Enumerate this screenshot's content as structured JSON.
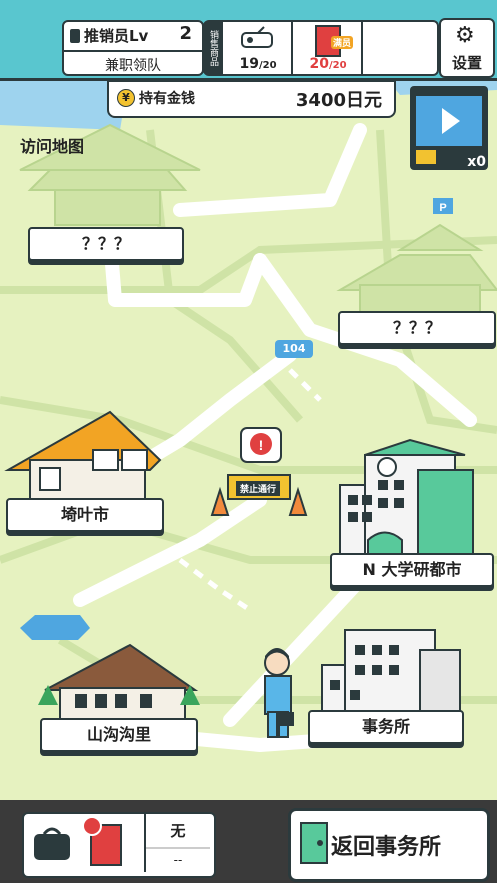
{
  "header": {
    "rank_label": "推销员Lv",
    "rank_level": "2",
    "team_name": "兼职领队",
    "sales_label": "销售商品",
    "slot1_count": "19",
    "slot1_max": "/20",
    "slot2_count": "20",
    "slot2_max": "/20",
    "slot2_badge": "满员",
    "settings_label": "设置"
  },
  "money": {
    "label": "持有金钱",
    "value": "3400日元"
  },
  "video": {
    "count": "x0"
  },
  "map": {
    "title": "访问地图",
    "road_number": "104",
    "blocked_label": "禁止通行",
    "places": [
      {
        "label": "？？？"
      },
      {
        "label": "？？？"
      },
      {
        "label": "埼叶市"
      },
      {
        "label": "N 大学研都市"
      },
      {
        "label": "山沟沟里"
      },
      {
        "label": "事务所"
      }
    ]
  },
  "bottom": {
    "item_name": "无",
    "item_sub": "--",
    "return_label": "返回事务所"
  },
  "colors": {
    "accent": "#59c6cf",
    "map_bg": "#e6f2c0",
    "road": "#ffffff",
    "dark": "#2b3a3d"
  }
}
